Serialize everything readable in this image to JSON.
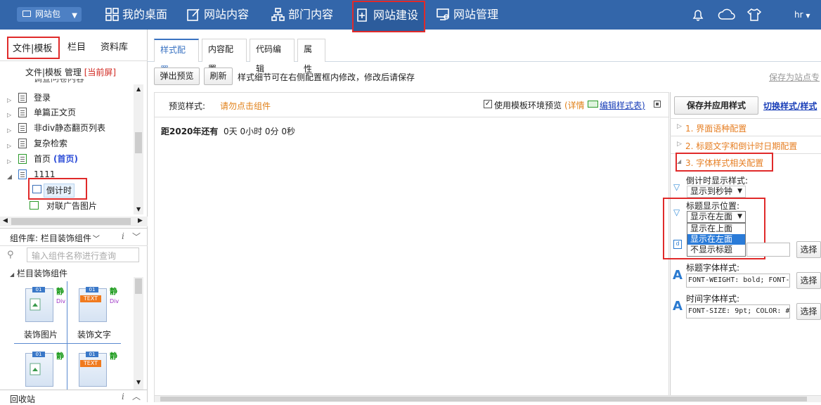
{
  "topbar": {
    "site_pill": "网站包",
    "nav": [
      "我的桌面",
      "网站内容",
      "部门内容",
      "网站建设",
      "网站管理"
    ],
    "user": "hr"
  },
  "left": {
    "tabs": [
      "文件|模板",
      "栏目",
      "资料库"
    ],
    "manage_a": "文件|模板 管理",
    "manage_b": "[当前屏]",
    "partial_top": "调查问卷内容",
    "tree": [
      "登录",
      "单篇正文页",
      "非div静态翻页列表",
      "复杂检索",
      "首页",
      "(首页)",
      "1111",
      "倒计时",
      "对联广告图片"
    ],
    "complib_label": "组件库:",
    "complib_value": "栏目装饰组件",
    "search_placeholder": "输入组件名称进行查询",
    "group": "栏目装饰组件",
    "comps": [
      "装饰图片",
      "装饰文字"
    ],
    "static": "静",
    "div": "Div",
    "tag01": "01",
    "tagtext": "TEXT",
    "recycle": "回收站"
  },
  "main": {
    "tabs": [
      "样式配置",
      "内容配置",
      "代码编辑",
      "属性"
    ],
    "popup_btn": "弹出预览",
    "refresh_btn": "刷新",
    "hint": "样式细节可在右侧配置框内修改，修改后请保存",
    "save_as": "保存为站点专",
    "preview_label": "预览样式:",
    "preview_warn": "请勿点击组件",
    "use_env": "使用模板环境预览",
    "detail": "(详情",
    "edit_style": "编辑样式表)",
    "countdown_title": "距2020年还有",
    "countdown_value": "0天 0小时 0分 0秒"
  },
  "right": {
    "save_apply": "保存并应用样式",
    "switch": "切换样式/样式",
    "sections": [
      "1. 界面语种配置",
      "2. 标题文字和倒计时日期配置",
      "3. 字体样式相关配置"
    ],
    "cd_style_label": "倒计时显示样式:",
    "cd_style_value": "显示到秒钟",
    "title_pos_label": "标题显示位置:",
    "title_pos_value": "显示在左面",
    "options": [
      "显示在上面",
      "显示在左面",
      "不显示标题"
    ],
    "title_font_label": "标题字体样式:",
    "title_font_value": "FONT-WEIGHT: bold; FONT-",
    "time_font_label": "时间字体样式:",
    "time_font_value": "FONT-SIZE: 9pt; COLOR: #",
    "choose": "选择"
  }
}
